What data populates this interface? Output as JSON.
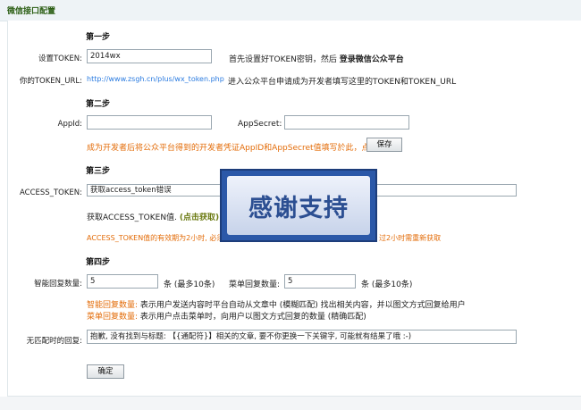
{
  "header": {
    "title": "微信接口配置"
  },
  "steps": {
    "step1": "第一步",
    "step2": "第二步",
    "step3": "第三步",
    "step4": "第四步"
  },
  "step1": {
    "token_label": "设置TOKEN:",
    "token_value": "2014wx",
    "token_hint_prefix": "首先设置好TOKEN密钥，然后",
    "token_hint_bold": "登录微信公众平台",
    "url_label": "你的TOKEN_URL:",
    "url_value": "http://www.zsgh.cn/plus/wx_token.php",
    "url_hint": "进入公众平台申请成为开发者填写这里的TOKEN和TOKEN_URL"
  },
  "step2": {
    "appid_label": "AppId:",
    "appid_value": "",
    "appsecret_label": "AppSecret:",
    "appsecret_value": "",
    "hint": "成为开发者后将公众平台得到的开发者凭证AppID和AppSecret值填写於此，点击:",
    "save_label": "保存"
  },
  "step3": {
    "access_label": "ACCESS_TOKEN:",
    "access_value": "获取access_token错误",
    "get_label": "获取ACCESS_TOKEN值.",
    "get_link": "(点击获取)",
    "note_left": "ACCESS_TOKEN值的有效期为2小时, 必须在",
    "note_right": "过2小时需重新获取"
  },
  "step4": {
    "smart_label": "智能回复数量:",
    "smart_value": "5",
    "smart_unit": "条 (最多10条)",
    "menu_label": "菜单回复数量:",
    "menu_value": "5",
    "menu_unit": "条 (最多10条)",
    "smart_desc_key": "智能回复数量:",
    "smart_desc": "表示用户发送内容时平台自动从文章中 (模糊匹配) 找出相关内容，并以图文方式回复给用户",
    "menu_desc_key": "菜单回复数量:",
    "menu_desc": "表示用户点击菜单时，向用户以图文方式回复的数量 (精确匹配)",
    "nomatch_label": "无匹配时的回复:",
    "nomatch_value": "抱歉, 没有找到与标题: 【{通配符}】相关的文章, 要不你更换一下关键字, 可能就有结果了哦 :-)"
  },
  "confirm_label": "确定",
  "overlay": {
    "text": "感谢支持"
  }
}
